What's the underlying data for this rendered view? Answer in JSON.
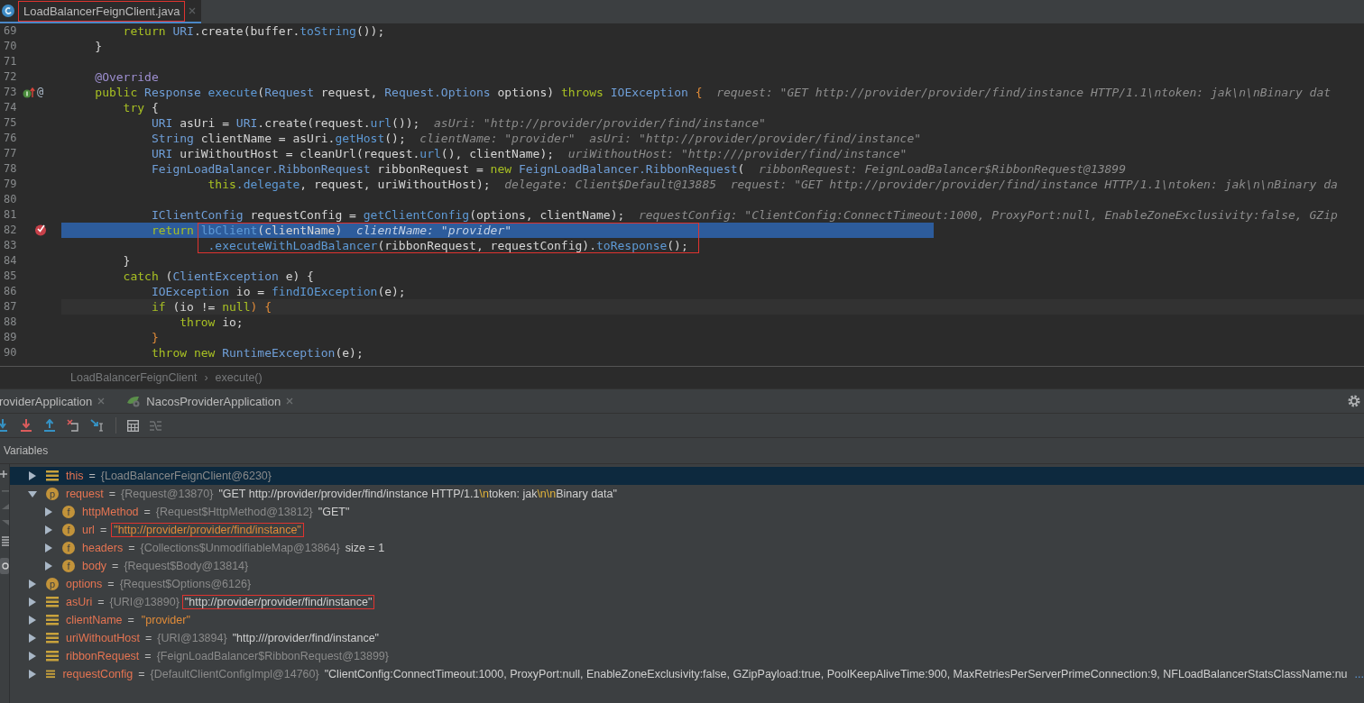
{
  "editor_tab": {
    "label": "LoadBalancerFeignClient.java",
    "selected": true,
    "boxed": true
  },
  "code_lines": [
    {
      "number": "69",
      "kind": "plain",
      "breakpoint": false,
      "code": [
        {
          "kind": "kw",
          "text": "        return "
        },
        {
          "kind": "type",
          "text": "URI"
        },
        {
          "kind": "plain",
          "text": ".create(buffer."
        },
        {
          "kind": "call",
          "text": "toString"
        },
        {
          "kind": "plain",
          "text": "());"
        }
      ]
    },
    {
      "number": "70",
      "kind": "plain",
      "breakpoint": false,
      "code": [
        {
          "kind": "plain",
          "text": "    }"
        }
      ]
    },
    {
      "number": "71",
      "kind": "plain",
      "breakpoint": false
    },
    {
      "number": "72",
      "kind": "plain",
      "breakpoint": false,
      "code": [
        {
          "kind": "anno",
          "text": "    @Override"
        }
      ]
    },
    {
      "number": "73",
      "kind": "override",
      "breakpoint": false,
      "gutter_text": "@",
      "code": [
        {
          "kind": "kw",
          "text": "    public "
        },
        {
          "kind": "type",
          "text": "Response "
        },
        {
          "kind": "call",
          "text": "execute"
        },
        {
          "kind": "plain",
          "text": "("
        },
        {
          "kind": "type",
          "text": "Request"
        },
        {
          "kind": "plain",
          "text": " request, "
        },
        {
          "kind": "type",
          "text": "Request.Options"
        },
        {
          "kind": "plain",
          "text": " options) "
        },
        {
          "kind": "kw",
          "text": "throws "
        },
        {
          "kind": "type",
          "text": "IOException"
        },
        {
          "kind": "brace",
          "text": " {"
        }
      ],
      "hint": "request: \"GET http://provider/provider/find/instance HTTP/1.1\\ntoken: jak\\n\\nBinary dat"
    },
    {
      "number": "74",
      "kind": "plain",
      "breakpoint": false,
      "code": [
        {
          "kind": "kw",
          "text": "        try"
        },
        {
          "kind": "plain",
          "text": " {"
        }
      ]
    },
    {
      "number": "75",
      "kind": "plain",
      "breakpoint": false,
      "code": [
        {
          "kind": "type",
          "text": "            URI"
        },
        {
          "kind": "plain",
          "text": " asUri = "
        },
        {
          "kind": "type",
          "text": "URI"
        },
        {
          "kind": "plain",
          "text": ".create(request."
        },
        {
          "kind": "call",
          "text": "url"
        },
        {
          "kind": "plain",
          "text": "());"
        }
      ],
      "hint": "asUri: \"http://provider/provider/find/instance\""
    },
    {
      "number": "76",
      "kind": "plain",
      "breakpoint": false,
      "code": [
        {
          "kind": "type",
          "text": "            String"
        },
        {
          "kind": "plain",
          "text": " clientName = asUri."
        },
        {
          "kind": "call",
          "text": "getHost"
        },
        {
          "kind": "plain",
          "text": "();"
        }
      ],
      "hint": "clientName: \"provider\"  asUri: \"http://provider/provider/find/instance\""
    },
    {
      "number": "77",
      "kind": "plain",
      "breakpoint": false,
      "code": [
        {
          "kind": "type",
          "text": "            URI"
        },
        {
          "kind": "plain",
          "text": " uriWithoutHost = cleanUrl(request."
        },
        {
          "kind": "call",
          "text": "url"
        },
        {
          "kind": "plain",
          "text": "(), clientName);"
        }
      ],
      "hint": "uriWithoutHost: \"http:///provider/find/instance\""
    },
    {
      "number": "78",
      "kind": "plain",
      "breakpoint": false,
      "code": [
        {
          "kind": "type",
          "text": "            FeignLoadBalancer.RibbonRequest"
        },
        {
          "kind": "plain",
          "text": " ribbonRequest = "
        },
        {
          "kind": "kw",
          "text": "new "
        },
        {
          "kind": "type",
          "text": "FeignLoadBalancer.RibbonRequest"
        },
        {
          "kind": "plain",
          "text": "("
        }
      ],
      "hint": "ribbonRequest: FeignLoadBalancer$RibbonRequest@13899"
    },
    {
      "number": "79",
      "kind": "plain",
      "breakpoint": false,
      "code": [
        {
          "kind": "kw",
          "text": "                    this"
        },
        {
          "kind": "call",
          "text": ".delegate"
        },
        {
          "kind": "plain",
          "text": ", request, uriWithoutHost);"
        }
      ],
      "hint": "delegate: Client$Default@13885  request: \"GET http://provider/provider/find/instance HTTP/1.1\\ntoken: jak\\n\\nBinary da"
    },
    {
      "number": "80",
      "kind": "plain",
      "breakpoint": false
    },
    {
      "number": "81",
      "kind": "plain",
      "breakpoint": false,
      "code": [
        {
          "kind": "type",
          "text": "            IClientConfig"
        },
        {
          "kind": "plain",
          "text": " requestConfig = "
        },
        {
          "kind": "call",
          "text": "getClientConfig"
        },
        {
          "kind": "plain",
          "text": "(options, clientName);"
        }
      ],
      "hint": "requestConfig: \"ClientConfig:ConnectTimeout:1000, ProxyPort:null, EnableZoneExclusivity:false, GZip"
    },
    {
      "number": "82",
      "kind": "execution",
      "breakpoint": true,
      "boxed": true,
      "code": [
        {
          "kind": "kw",
          "text": "            return "
        },
        {
          "kind": "call",
          "text": "lbClient"
        },
        {
          "kind": "plain",
          "text": "(clientName)"
        }
      ],
      "hint": "clientName: \"provider\""
    },
    {
      "number": "83",
      "kind": "plain",
      "breakpoint": false,
      "boxed": true,
      "code": [
        {
          "kind": "call",
          "text": "                    .executeWithLoadBalancer"
        },
        {
          "kind": "plain",
          "text": "(ribbonRequest, requestConfig)."
        },
        {
          "kind": "call",
          "text": "toResponse"
        },
        {
          "kind": "plain",
          "text": "();"
        }
      ]
    },
    {
      "number": "84",
      "kind": "plain",
      "breakpoint": false,
      "code": [
        {
          "kind": "plain",
          "text": "        }"
        }
      ]
    },
    {
      "number": "85",
      "kind": "plain",
      "breakpoint": false,
      "code": [
        {
          "kind": "kw",
          "text": "        catch"
        },
        {
          "kind": "plain",
          "text": " ("
        },
        {
          "kind": "type",
          "text": "ClientException"
        },
        {
          "kind": "plain",
          "text": " e) {"
        }
      ]
    },
    {
      "number": "86",
      "kind": "plain",
      "breakpoint": false,
      "code": [
        {
          "kind": "type",
          "text": "            IOException"
        },
        {
          "kind": "plain",
          "text": " io = "
        },
        {
          "kind": "call",
          "text": "findIOException"
        },
        {
          "kind": "plain",
          "text": "(e);"
        }
      ]
    },
    {
      "number": "87",
      "kind": "caret",
      "breakpoint": false,
      "code": [
        {
          "kind": "kw",
          "text": "            if"
        },
        {
          "kind": "plain",
          "text": " (io != "
        },
        {
          "kind": "kw",
          "text": "null"
        },
        {
          "kind": "brace",
          "text": ") {"
        }
      ]
    },
    {
      "number": "88",
      "kind": "plain",
      "breakpoint": false,
      "code": [
        {
          "kind": "kw",
          "text": "                throw"
        },
        {
          "kind": "plain",
          "text": " io;"
        }
      ]
    },
    {
      "number": "89",
      "kind": "plain",
      "breakpoint": false,
      "code": [
        {
          "kind": "brace",
          "text": "            }"
        }
      ]
    },
    {
      "number": "90",
      "kind": "plain",
      "breakpoint": false,
      "code": [
        {
          "kind": "kw",
          "text": "            throw new "
        },
        {
          "kind": "type",
          "text": "RuntimeException"
        },
        {
          "kind": "plain",
          "text": "(e);"
        }
      ]
    }
  ],
  "breadcrumb": [
    "LoadBalancerFeignClient",
    "execute()"
  ],
  "breadcrumb_separator": "›",
  "debug_tabs": [
    {
      "label": "roviderApplication",
      "kind": "plain"
    },
    {
      "label": "NacosProviderApplication",
      "kind": "app"
    }
  ],
  "variables_title": "Variables",
  "variables": [
    {
      "name": "this",
      "op": "=",
      "kind": "local",
      "ref": "{LoadBalancerFeignClient@6230}",
      "selected": true,
      "expanded": false
    },
    {
      "name": "request",
      "op": "=",
      "kind": "param",
      "badge": "p",
      "ref": "{Request@13870}",
      "value": [
        {
          "kind": "plain",
          "text": "\"GET http://provider/provider/find/instance HTTP/1.1"
        },
        {
          "kind": "escape",
          "text": "\\n"
        },
        {
          "kind": "plain",
          "text": "token: jak"
        },
        {
          "kind": "escape",
          "text": "\\n\\n"
        },
        {
          "kind": "plain",
          "text": "Binary data\""
        }
      ],
      "selected": false,
      "expanded": true,
      "children": [
        {
          "name": "httpMethod",
          "op": "=",
          "kind": "field",
          "badge": "f",
          "ref": "{Request$HttpMethod@13812}",
          "value": [
            {
              "kind": "plain",
              "text": "\"GET\""
            }
          ],
          "selected": false,
          "expanded": false
        },
        {
          "name": "url",
          "op": "=",
          "kind": "field",
          "badge": "f",
          "value": [
            {
              "kind": "string",
              "text": "\"http://provider/provider/find/instance\""
            }
          ],
          "boxed": true,
          "selected": false,
          "expanded": false
        },
        {
          "name": "headers",
          "op": "=",
          "kind": "field",
          "badge": "f",
          "ref": "{Collections$UnmodifiableMap@13864}",
          "value": [
            {
              "kind": "plain",
              "text": "size = 1"
            }
          ],
          "selected": false,
          "expanded": false
        },
        {
          "name": "body",
          "op": "=",
          "kind": "field",
          "badge": "f",
          "ref": "{Request$Body@13814}",
          "selected": false,
          "expanded": false
        }
      ]
    },
    {
      "name": "options",
      "op": "=",
      "kind": "param",
      "badge": "p",
      "ref": "{Request$Options@6126}",
      "selected": false,
      "expanded": false
    },
    {
      "name": "asUri",
      "op": "=",
      "kind": "local",
      "ref": "{URI@13890}",
      "value": [
        {
          "kind": "plain",
          "text": "\"http://provider/provider/find/instance\""
        }
      ],
      "boxed": true,
      "selected": false,
      "expanded": false
    },
    {
      "name": "clientName",
      "op": "=",
      "kind": "local",
      "value": [
        {
          "kind": "string",
          "text": "\"provider\""
        }
      ],
      "selected": false,
      "expanded": false
    },
    {
      "name": "uriWithoutHost",
      "op": "=",
      "kind": "local",
      "ref": "{URI@13894}",
      "value": [
        {
          "kind": "plain",
          "text": "\"http:///provider/find/instance\""
        }
      ],
      "selected": false,
      "expanded": false
    },
    {
      "name": "ribbonRequest",
      "op": "=",
      "kind": "local",
      "ref": "{FeignLoadBalancer$RibbonRequest@13899}",
      "selected": false,
      "expanded": false
    },
    {
      "name": "requestConfig",
      "op": "=",
      "kind": "local",
      "ref": "{DefaultClientConfigImpl@14760}",
      "value": [
        {
          "kind": "plain",
          "text": "\"ClientConfig:ConnectTimeout:1000, ProxyPort:null, EnableZoneExclusivity:false, GZipPayload:true, PoolKeepAliveTime:900, MaxRetriesPerServerPrimeConnection:9, NFLoadBalancerStatsClassName:nu"
        }
      ],
      "more": "...",
      "selected": false,
      "expanded": false
    }
  ]
}
